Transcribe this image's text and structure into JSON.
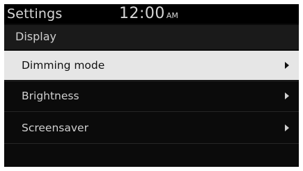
{
  "status_bar": {
    "title": "Settings",
    "time": "12:00",
    "ampm": "AM"
  },
  "section": {
    "title": "Display"
  },
  "menu": {
    "selected_index": 0,
    "items": [
      {
        "label": "Dimming mode",
        "icon": "chevron-right-icon"
      },
      {
        "label": "Brightness",
        "icon": "chevron-right-icon"
      },
      {
        "label": "Screensaver",
        "icon": "chevron-right-icon"
      }
    ]
  },
  "colors": {
    "background": "#0b0b0b",
    "status_bar": "#000000",
    "section_header": "#1a1a1a",
    "selected_row": "#e6e6e6",
    "text": "#cfcfcf",
    "selected_text": "#111111"
  }
}
